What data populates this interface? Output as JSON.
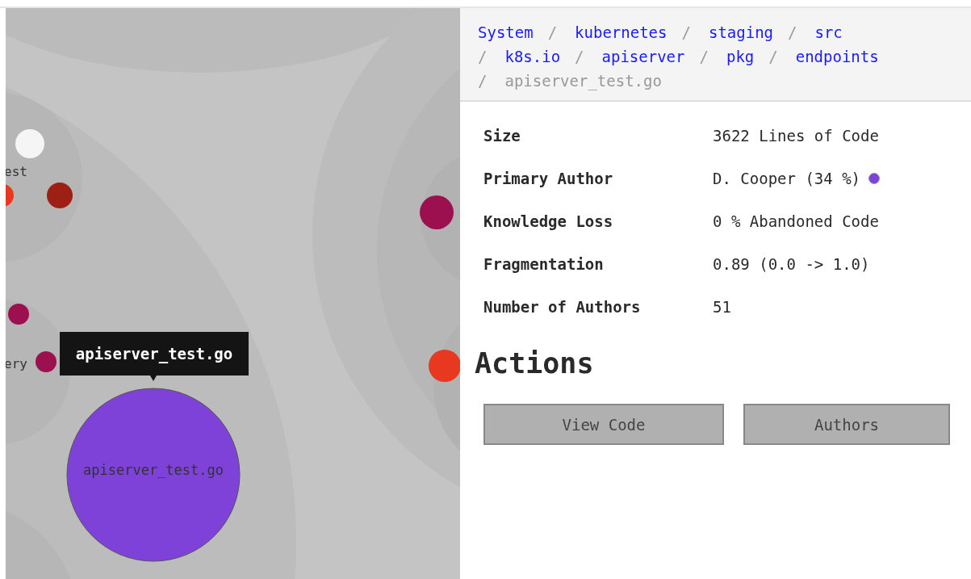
{
  "map": {
    "labels": [
      {
        "text": "est"
      },
      {
        "text": "ery"
      }
    ],
    "nodes": [
      {
        "color": "#f5f5f5"
      },
      {
        "color": "#e8381f"
      },
      {
        "color": "#9e1f14"
      },
      {
        "color": "#9c1050"
      },
      {
        "color": "#9c1050"
      },
      {
        "color": "#9c1050"
      },
      {
        "color": "#e8381f"
      },
      {
        "color": "#7f42d8",
        "label": "apiserver_test.go"
      }
    ],
    "tooltip": "apiserver_test.go"
  },
  "breadcrumb": [
    {
      "label": "System",
      "current": false
    },
    {
      "separator": "/",
      "label": "kubernetes",
      "current": false
    },
    {
      "separator": "/",
      "label": "staging",
      "current": false
    },
    {
      "separator": "/",
      "label": "src",
      "current": false
    },
    {
      "separator": "/",
      "label": "k8s.io",
      "current": false
    },
    {
      "separator": "/",
      "label": "apiserver",
      "current": false
    },
    {
      "separator": "/",
      "label": "pkg",
      "current": false
    },
    {
      "separator": "/",
      "label": "endpoints",
      "current": false
    },
    {
      "separator": "/",
      "label": "apiserver_test.go",
      "current": true
    }
  ],
  "details": [
    {
      "label": "Size",
      "value": "3622 Lines of Code"
    },
    {
      "label": "Primary Author",
      "value": "D. Cooper (34 %)",
      "color": "#7f42d8"
    },
    {
      "label": "Knowledge Loss",
      "value": "0 % Abandoned Code"
    },
    {
      "label": "Fragmentation",
      "value": "0.89 (0.0 -> 1.0)"
    },
    {
      "label": "Number of Authors",
      "value": "51"
    }
  ],
  "actions": {
    "title": "Actions",
    "buttons": [
      "View Code",
      "Authors"
    ]
  }
}
